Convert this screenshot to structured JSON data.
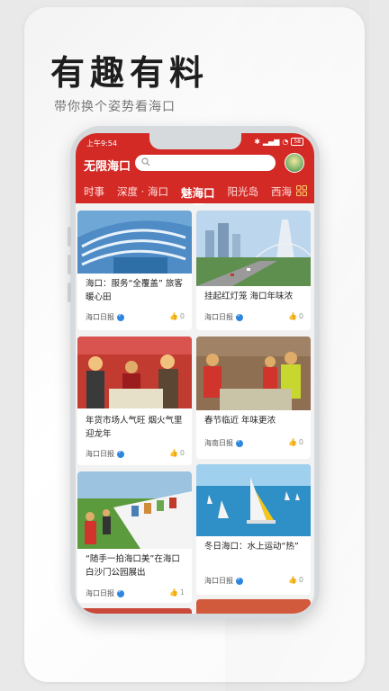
{
  "promo": {
    "headline": "有趣有料",
    "subline": "带你换个姿势看海口"
  },
  "status_bar": {
    "time": "上午9:54",
    "battery": "58"
  },
  "app": {
    "title": "无限海口",
    "search_placeholder": ""
  },
  "tabs": [
    {
      "label": "时事",
      "active": false
    },
    {
      "label": "深度 · 海口",
      "active": false
    },
    {
      "label": "魅海口",
      "active": true
    },
    {
      "label": "阳光岛",
      "active": false
    },
    {
      "label": "西海",
      "active": false
    }
  ],
  "feed": [
    {
      "title": "海口：服务“全覆盖” 旅客暖心田",
      "source": "海口日报",
      "likes": "0"
    },
    {
      "title": "挂起红灯笼 海口年味浓",
      "source": "海口日报",
      "likes": "0"
    },
    {
      "title": "年货市场人气旺 烟火气里迎龙年",
      "source": "海口日报",
      "likes": "0"
    },
    {
      "title": "春节临近 年味更浓",
      "source": "海南日报",
      "likes": "0"
    },
    {
      "title": "“随手一拍海口美”在海口白沙门公园展出",
      "source": "海口日报",
      "likes": "1"
    },
    {
      "title": "冬日海口：水上运动“热”",
      "source": "海口日报",
      "likes": "0"
    }
  ],
  "colors": {
    "brand_red": "#d42a25",
    "verified_blue": "#2e86de"
  }
}
